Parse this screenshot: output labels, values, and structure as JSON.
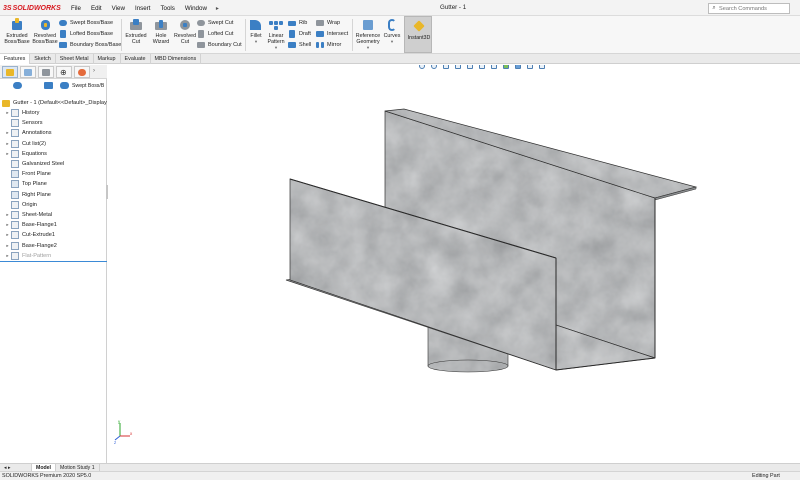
{
  "app": {
    "logo_text": "SOLIDWORKS",
    "logo_mark": "3S",
    "document_title": "Gutter - 1",
    "search_placeholder": "Search Commands",
    "menus": [
      "File",
      "Edit",
      "View",
      "Insert",
      "Tools",
      "Window"
    ]
  },
  "ribbon": {
    "extruded_boss": "Extruded Boss/Base",
    "revolved_boss": "Revolved Boss/Base",
    "swept_boss": "Swept Boss/Base",
    "lofted_boss": "Lofted Boss/Base",
    "boundary_boss": "Boundary Boss/Base",
    "extruded_cut": "Extruded Cut",
    "hole_wizard": "Hole Wizard",
    "revolved_cut": "Revolved Cut",
    "swept_cut": "Swept Cut",
    "lofted_cut": "Lofted Cut",
    "boundary_cut": "Boundary Cut",
    "fillet": "Fillet",
    "linear_pattern": "Linear Pattern",
    "rib": "Rib",
    "draft": "Draft",
    "shell": "Shell",
    "wrap": "Wrap",
    "intersect": "Intersect",
    "mirror": "Mirror",
    "reference_geometry": "Reference Geometry",
    "curves": "Curves",
    "instant3d": "Instant3D"
  },
  "tabs": [
    "Features",
    "Sketch",
    "Sheet Metal",
    "Markup",
    "Evaluate",
    "MBD Dimensions"
  ],
  "feature_manager": {
    "mini_toolbar_label": "Swept Boss/B",
    "root": "Gutter - 1  (Default<<Default>_Display",
    "items": [
      {
        "label": "History",
        "arrow": true
      },
      {
        "label": "Sensors",
        "arrow": false
      },
      {
        "label": "Annotations",
        "arrow": true
      },
      {
        "label": "Cut list(2)",
        "arrow": true
      },
      {
        "label": "Equations",
        "arrow": true
      },
      {
        "label": "Galvanized Steel",
        "arrow": false
      },
      {
        "label": "Front Plane",
        "arrow": false
      },
      {
        "label": "Top Plane",
        "arrow": false
      },
      {
        "label": "Right Plane",
        "arrow": false
      },
      {
        "label": "Origin",
        "arrow": false
      },
      {
        "label": "Sheet-Metal",
        "arrow": true
      },
      {
        "label": "Base-Flange1",
        "arrow": true
      },
      {
        "label": "Cut-Extrude1",
        "arrow": true
      },
      {
        "label": "Base-Flange2",
        "arrow": true
      },
      {
        "label": "Flat-Pattern",
        "arrow": true
      }
    ]
  },
  "triad": {
    "x": "x",
    "y": "y",
    "z": "z"
  },
  "bottom_tabs": [
    "Model",
    "Motion Study 1"
  ],
  "status": {
    "left": "SOLIDWORKS Premium 2020 SP5.0",
    "right": "Editing Part"
  },
  "colors": {
    "accent_red": "#d71920",
    "selection_blue": "#3b8ad6",
    "metal_dark": "#6b6e70",
    "metal_light": "#9a9d9f"
  }
}
